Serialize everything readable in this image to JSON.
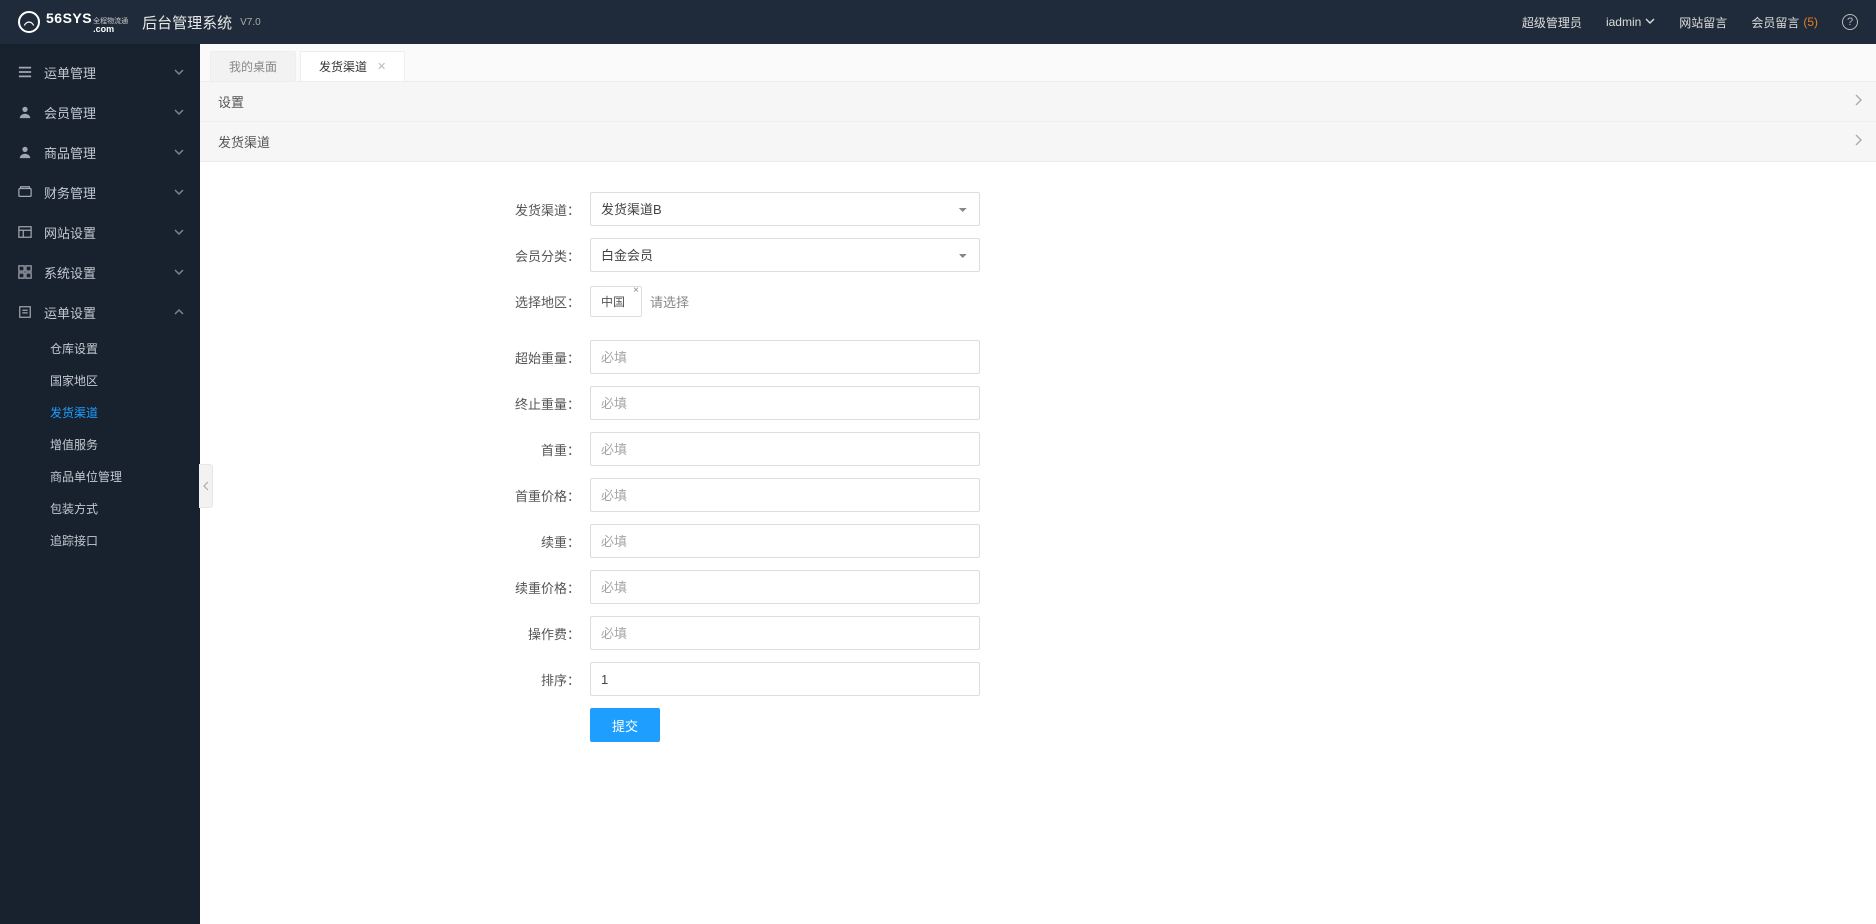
{
  "header": {
    "brand_main": "56SYS",
    "brand_sub": ".com",
    "brand_tag": "全程物流通",
    "title": "后台管理系统",
    "version": "V7.0",
    "role": "超级管理员",
    "user": "iadmin",
    "site_msg": "网站留言",
    "member_msg": "会员留言",
    "member_msg_count": "(5)"
  },
  "sidebar": {
    "items": [
      {
        "label": "运单管理",
        "icon": "order"
      },
      {
        "label": "会员管理",
        "icon": "user"
      },
      {
        "label": "商品管理",
        "icon": "user"
      },
      {
        "label": "财务管理",
        "icon": "finance"
      },
      {
        "label": "网站设置",
        "icon": "site"
      },
      {
        "label": "系统设置",
        "icon": "system"
      },
      {
        "label": "运单设置",
        "icon": "order",
        "expanded": true
      }
    ],
    "sub": [
      {
        "label": "仓库设置"
      },
      {
        "label": "国家地区"
      },
      {
        "label": "发货渠道",
        "active": true
      },
      {
        "label": "增值服务"
      },
      {
        "label": "商品单位管理"
      },
      {
        "label": "包装方式"
      },
      {
        "label": "追踪接口"
      }
    ]
  },
  "tabs": [
    {
      "label": "我的桌面",
      "closable": false,
      "active": false
    },
    {
      "label": "发货渠道",
      "closable": true,
      "active": true
    }
  ],
  "panels": {
    "settings": "设置",
    "channel": "发货渠道"
  },
  "form": {
    "channel": {
      "label": "发货渠道：",
      "value": "发货渠道B"
    },
    "member_cat": {
      "label": "会员分类：",
      "value": "白金会员"
    },
    "region": {
      "label": "选择地区：",
      "tag": "中国",
      "prompt": "请选择"
    },
    "start_weight": {
      "label": "超始重量：",
      "placeholder": "必填",
      "value": ""
    },
    "end_weight": {
      "label": "终止重量：",
      "placeholder": "必填",
      "value": ""
    },
    "first_weight": {
      "label": "首重：",
      "placeholder": "必填",
      "value": ""
    },
    "first_price": {
      "label": "首重价格：",
      "placeholder": "必填",
      "value": ""
    },
    "cont_weight": {
      "label": "续重：",
      "placeholder": "必填",
      "value": ""
    },
    "cont_price": {
      "label": "续重价格：",
      "placeholder": "必填",
      "value": ""
    },
    "op_fee": {
      "label": "操作费：",
      "placeholder": "必填",
      "value": ""
    },
    "sort": {
      "label": "排序：",
      "value": "1"
    },
    "submit": "提交"
  }
}
